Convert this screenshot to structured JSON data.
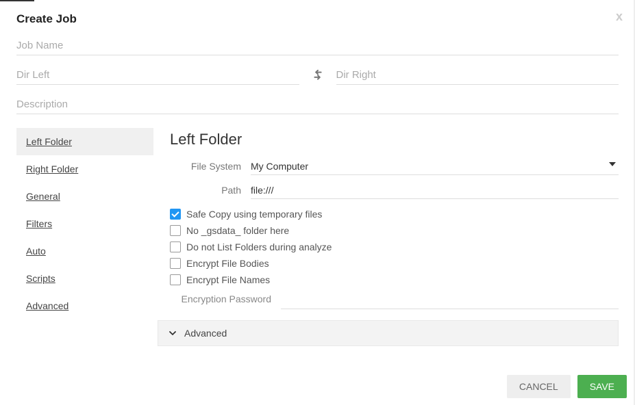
{
  "dialog": {
    "title": "Create Job",
    "close": "x"
  },
  "fields": {
    "job_name_placeholder": "Job Name",
    "dir_left_placeholder": "Dir Left",
    "dir_right_placeholder": "Dir Right",
    "description_placeholder": "Description"
  },
  "sidebar": {
    "items": [
      {
        "label": "Left Folder",
        "active": true
      },
      {
        "label": "Right Folder",
        "active": false
      },
      {
        "label": "General",
        "active": false
      },
      {
        "label": "Filters",
        "active": false
      },
      {
        "label": "Auto",
        "active": false
      },
      {
        "label": "Scripts",
        "active": false
      },
      {
        "label": "Advanced",
        "active": false
      }
    ]
  },
  "panel": {
    "title": "Left Folder",
    "file_system_label": "File System",
    "file_system_value": "My Computer",
    "path_label": "Path",
    "path_value": "file:///",
    "checks": [
      {
        "label": "Safe Copy using temporary files",
        "checked": true
      },
      {
        "label": "No _gsdata_ folder here",
        "checked": false
      },
      {
        "label": "Do not List Folders during analyze",
        "checked": false
      },
      {
        "label": "Encrypt File Bodies",
        "checked": false
      },
      {
        "label": "Encrypt File Names",
        "checked": false
      }
    ],
    "encryption_label": "Encryption Password",
    "encryption_value": "",
    "advanced_label": "Advanced"
  },
  "footer": {
    "cancel": "CANCEL",
    "save": "SAVE"
  }
}
